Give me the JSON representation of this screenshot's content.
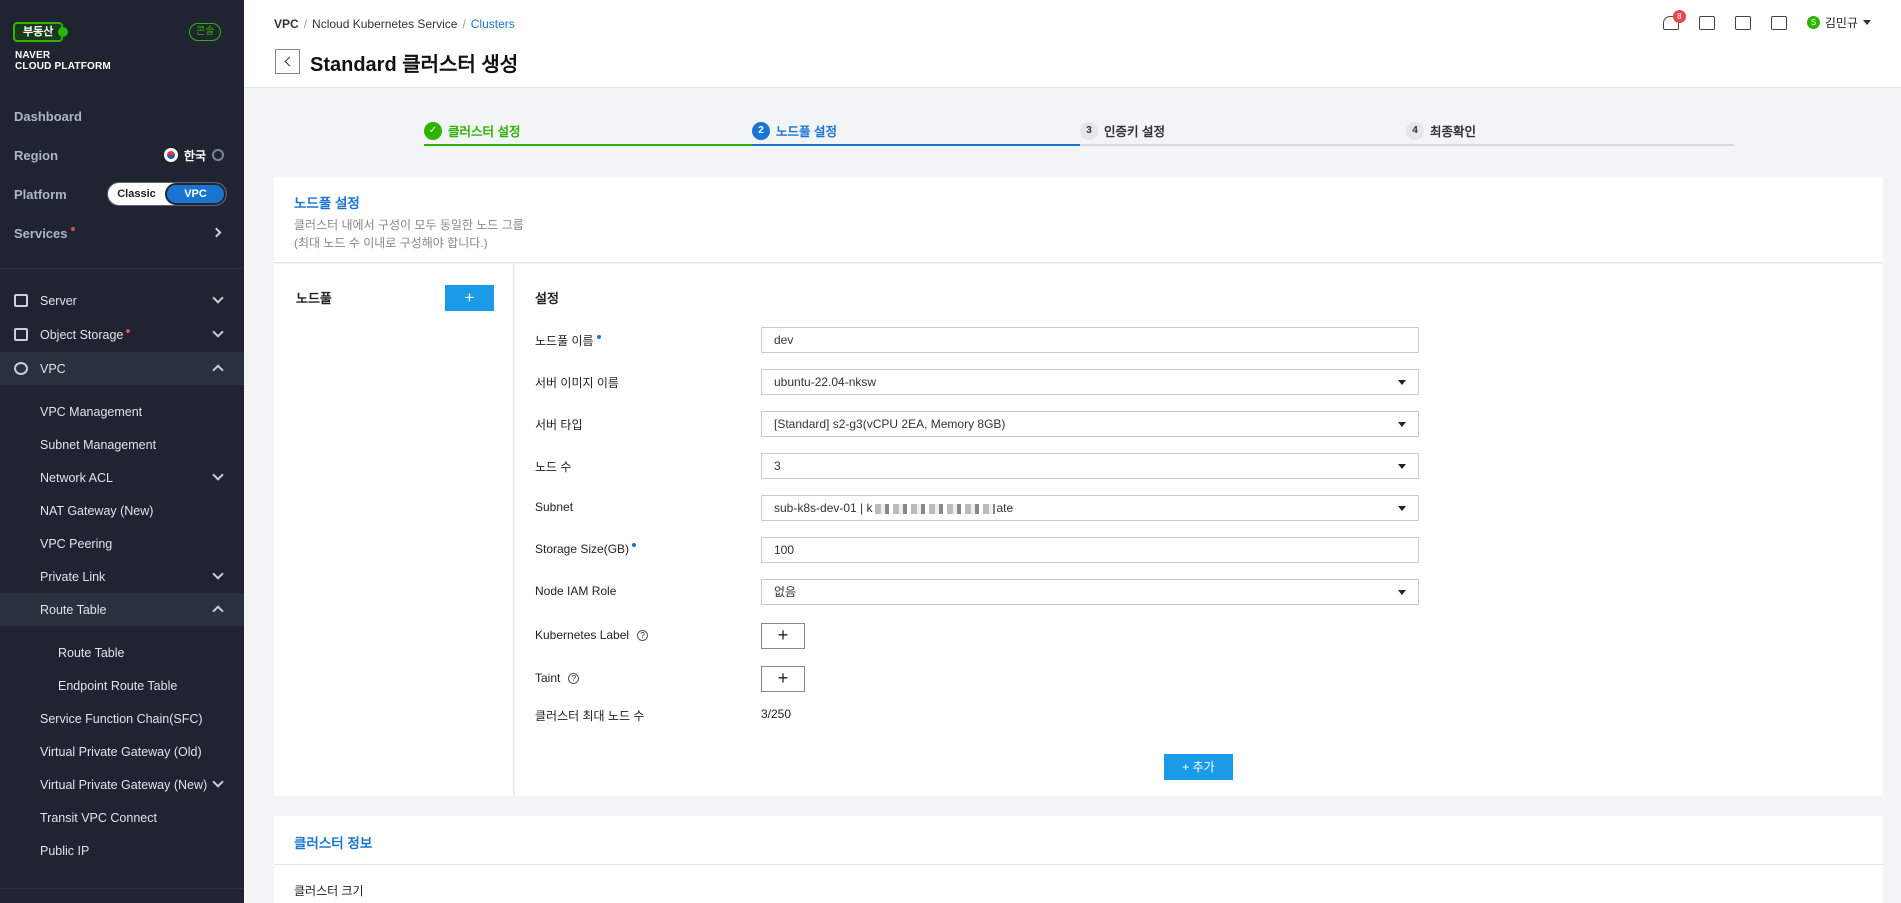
{
  "sidebar": {
    "brand_badge": "부동산",
    "brand_line1": "NAVER",
    "brand_line2": "CLOUD PLATFORM",
    "login_badge": "콘솔",
    "dashboard": "Dashboard",
    "region_label": "Region",
    "region_value": "한국",
    "platform_label": "Platform",
    "platform_options": [
      "Classic",
      "VPC"
    ],
    "platform_selected": "VPC",
    "services_label": "Services",
    "menu": {
      "server": "Server",
      "object_storage": "Object Storage",
      "vpc": "VPC"
    },
    "vpc_items": {
      "vpc_management": "VPC Management",
      "subnet_management": "Subnet Management",
      "network_acl": "Network ACL",
      "nat_gateway": "NAT Gateway (New)",
      "vpc_peering": "VPC Peering",
      "private_link": "Private Link",
      "route_table": "Route Table",
      "route_table_sub": "Route Table",
      "endpoint_route_table": "Endpoint Route Table",
      "sfc": "Service Function Chain(SFC)",
      "vpg_old": "Virtual Private Gateway (Old)",
      "vpg_new": "Virtual Private Gateway (New)",
      "transit_vpc": "Transit VPC Connect",
      "public_ip": "Public IP"
    }
  },
  "header": {
    "breadcrumb": [
      "VPC",
      "Ncloud Kubernetes Service",
      "Clusters"
    ],
    "breadcrumb_sep": "/",
    "title": "Standard 클러스터 생성",
    "notification_count": "8",
    "user_initial": "S",
    "user_name": "김민규"
  },
  "stepper": {
    "steps": [
      {
        "num": "✓",
        "label": "클러스터 설정",
        "state": "done"
      },
      {
        "num": "2",
        "label": "노드풀 설정",
        "state": "current"
      },
      {
        "num": "3",
        "label": "인증키 설정",
        "state": "todo"
      },
      {
        "num": "4",
        "label": "최종확인",
        "state": "todo"
      }
    ]
  },
  "nodepool_section": {
    "title": "노드풀 설정",
    "desc1": "클러스터 내에서 구성이 모두 동일한 노드 그룹",
    "desc2": "(최대 노드 수 이내로 구성해야 합니다.)",
    "left_title": "노드풀",
    "add_icon": "+",
    "settings_title": "설정",
    "fields": {
      "name_label": "노드풀 이름",
      "name_value": "dev",
      "image_label": "서버 이미지 이름",
      "image_value": "ubuntu-22.04-nksw",
      "type_label": "서버 타입",
      "type_value": "[Standard] s2-g3(vCPU 2EA, Memory 8GB)",
      "count_label": "노드 수",
      "count_value": "3",
      "subnet_label": "Subnet",
      "subnet_value_prefix": "sub-k8s-dev-01 | k",
      "subnet_value_suffix": "ate",
      "storage_label": "Storage Size(GB)",
      "storage_value": "100",
      "iam_label": "Node IAM Role",
      "iam_value": "없음",
      "k8s_label": "Kubernetes Label",
      "taint_label": "Taint",
      "max_nodes_label": "클러스터 최대 노드 수",
      "max_nodes_value": "3/250",
      "plus": "+",
      "help": "?"
    },
    "add_button": "+ 추가"
  },
  "cluster_info": {
    "title": "클러스터 정보",
    "size_label": "클러스터 크기"
  },
  "colors": {
    "sidebar_bg": "#1f2430",
    "accent_blue": "#1a75d1",
    "button_blue": "#1a9be8",
    "brand_green": "#2db400",
    "alert_red": "#e54848"
  }
}
